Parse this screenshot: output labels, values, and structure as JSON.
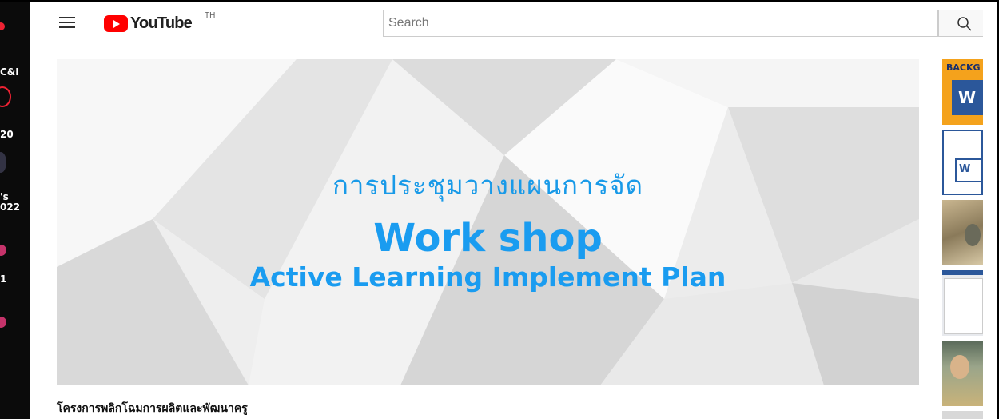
{
  "header": {
    "logo_text": "YouTube",
    "country_code": "TH",
    "search_placeholder": "Search"
  },
  "left_strip": {
    "partial_labels": [
      "C&I",
      "20",
      "'s",
      "022",
      "1"
    ]
  },
  "main_video": {
    "thumbnail_line1": "การประชุมวางแผนการจัด",
    "thumbnail_line2": "Work shop",
    "thumbnail_line3": "Active Learning Implement Plan",
    "title": "โครงการพลิกโฉมการผลิตและพัฒนาครู"
  },
  "sidebar_thumbs": [
    {
      "text": "BACKG",
      "letter": "W",
      "bg": "#f4a21c"
    },
    {
      "text": "",
      "letter": "W",
      "bg": "#ffffff"
    },
    {
      "text": "",
      "letter": "",
      "bg": "#b8a580"
    },
    {
      "text": "",
      "letter": "",
      "bg": "#e8eaee"
    },
    {
      "text": "",
      "letter": "",
      "bg": "#7a8d7a"
    }
  ],
  "colors": {
    "accent_blue": "#1a9cf0",
    "brand_red": "#ff0000"
  }
}
